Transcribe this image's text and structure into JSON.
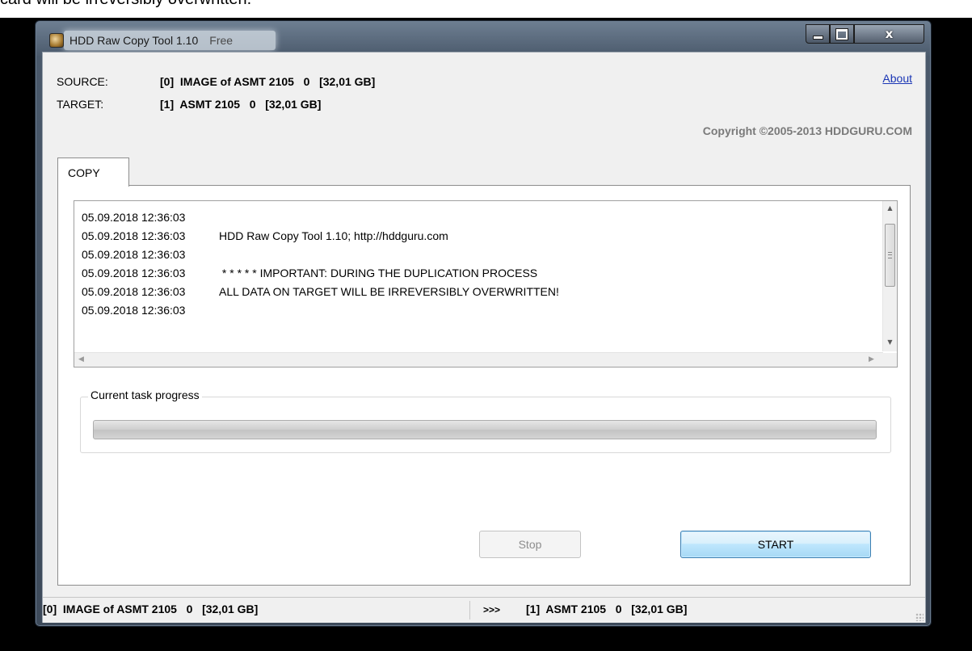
{
  "caption": "card will be irreversibly overwritten.",
  "window": {
    "title": "HDD Raw Copy Tool 1.10",
    "edition": "Free",
    "close_glyph": "x"
  },
  "header": {
    "source_label": "SOURCE:",
    "source_value": "[0]  IMAGE of ASMT 2105   0   [32,01 GB]",
    "target_label": "TARGET:",
    "target_value": "[1]  ASMT 2105   0   [32,01 GB]",
    "about_link": "About",
    "copyright": "Copyright ©2005-2013 HDDGURU.COM"
  },
  "tabs": [
    {
      "label": "COPY",
      "selected": true
    }
  ],
  "log": {
    "lines": [
      {
        "time": "05.09.2018 12:36:03",
        "text": ""
      },
      {
        "time": "05.09.2018 12:36:03",
        "text": "HDD Raw Copy Tool 1.10; http://hddguru.com"
      },
      {
        "time": "05.09.2018 12:36:03",
        "text": ""
      },
      {
        "time": "05.09.2018 12:36:03",
        "text": " * * * * * IMPORTANT: DURING THE DUPLICATION PROCESS"
      },
      {
        "time": "05.09.2018 12:36:03",
        "text": "ALL DATA ON TARGET WILL BE IRREVERSIBLY OVERWRITTEN!"
      },
      {
        "time": "05.09.2018 12:36:03",
        "text": ""
      }
    ]
  },
  "progress": {
    "group_label": "Current task progress",
    "value_fraction": 0
  },
  "buttons": {
    "stop_label": "Stop",
    "stop_enabled": false,
    "start_label": "START"
  },
  "statusbar": {
    "source": "[0]  IMAGE of ASMT 2105   0   [32,01 GB]",
    "arrow": ">>>",
    "target": "[1]  ASMT 2105   0   [32,01 GB]"
  },
  "icons": {
    "app": "hdd-app-icon",
    "scroll_up": "arrow-up-icon",
    "scroll_down": "arrow-down-icon",
    "scroll_left": "arrow-left-icon",
    "scroll_right": "arrow-right-icon"
  },
  "colors": {
    "link": "#1a36b5",
    "start_button": "#bee6fd",
    "copyright": "#7a7a7a"
  }
}
